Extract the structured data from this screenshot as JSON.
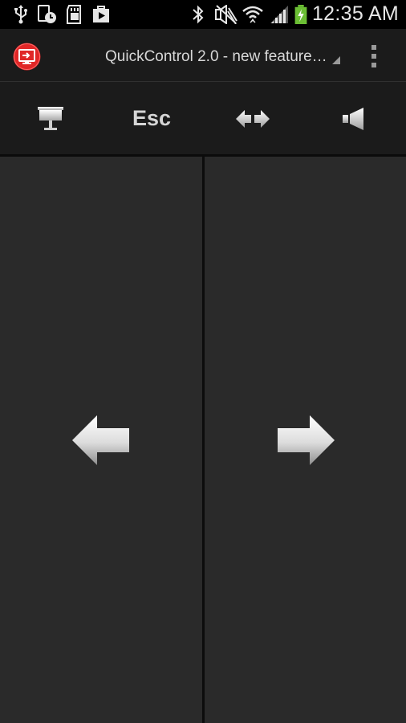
{
  "status_bar": {
    "time": "12:35 AM",
    "icons": [
      "usb-icon",
      "alarm-clock-icon",
      "sd-card-icon",
      "play-store-icon",
      "bluetooth-icon",
      "mute-icon",
      "wifi-icon",
      "signal-icon",
      "battery-charging-icon"
    ]
  },
  "action_bar": {
    "app_icon": "quickcontrol-app-icon",
    "title": "QuickControl 2.0 - new feature…",
    "menu_icon": "overflow-menu-icon"
  },
  "toolbar": {
    "presentation_icon": "projector-screen-icon",
    "esc_label": "Esc",
    "arrows_icon": "left-right-arrows-icon",
    "volume_icon": "speaker-icon"
  },
  "panels": {
    "left_icon": "arrow-left-icon",
    "right_icon": "arrow-right-icon"
  },
  "colors": {
    "background": "#000000",
    "actionbar": "#1b1b1b",
    "panel": "#2a2a2a",
    "app_icon_red": "#e02727",
    "battery_green": "#6bbe34"
  }
}
